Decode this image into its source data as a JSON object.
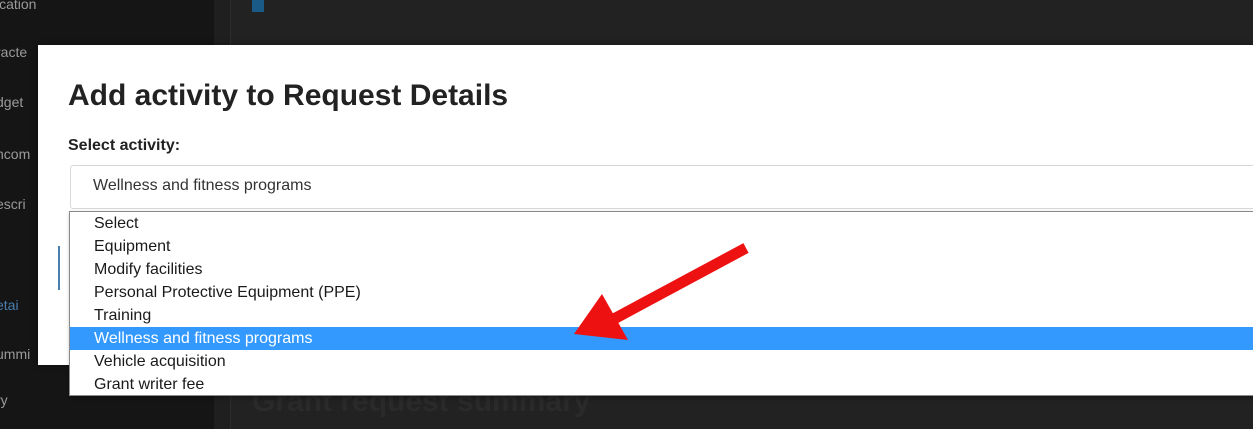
{
  "background": {
    "sidebar_items": [
      "ication",
      "racte",
      "dget",
      "ncom",
      "escri",
      "etai",
      "ummi",
      "ry"
    ],
    "heading": "Grant request summary"
  },
  "modal": {
    "title": "Add activity to Request Details",
    "field_label": "Select activity:",
    "select_value": "Wellness and fitness programs"
  },
  "dropdown": {
    "options": [
      "Select",
      "Equipment",
      "Modify facilities",
      "Personal Protective Equipment (PPE)",
      "Training",
      "Wellness and fitness programs",
      "Vehicle acquisition",
      "Grant writer fee"
    ],
    "selected_index": 5
  },
  "colors": {
    "highlight": "#3399ff",
    "arrow": "#ee1111"
  }
}
